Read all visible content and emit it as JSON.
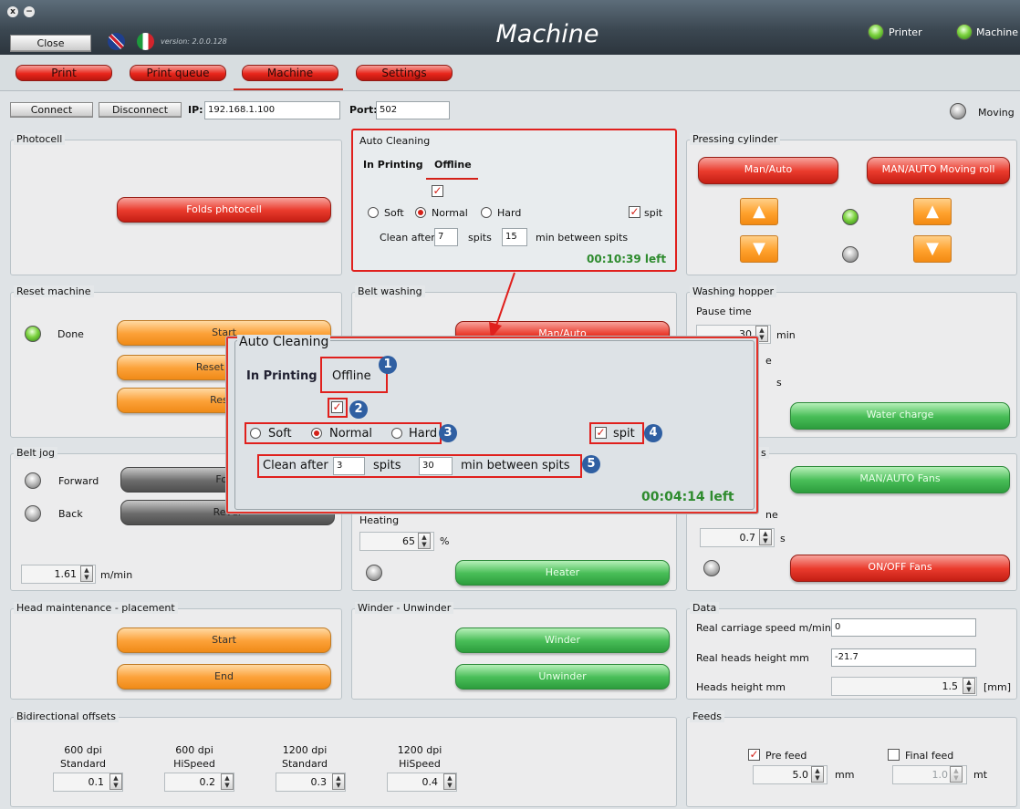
{
  "window": {
    "title": "Machine",
    "version": "version: 2.0.0.128",
    "close_label": "Close",
    "close_glyph": "x",
    "minimize_glyph": "−"
  },
  "status": {
    "printer": "Printer",
    "machine": "Machine",
    "moving": "Moving"
  },
  "tabs": [
    "Print",
    "Print queue",
    "Machine",
    "Settings"
  ],
  "connection": {
    "connect": "Connect",
    "disconnect": "Disconnect",
    "ip_label": "IP:",
    "ip_value": "192.168.1.100",
    "port_label": "Port:",
    "port_value": "502"
  },
  "photocell": {
    "title": "Photocell",
    "button": "Folds photocell"
  },
  "auto_cleaning": {
    "title": "Auto Cleaning",
    "tab_in_printing": "In Printing",
    "tab_offline": "Offline",
    "soft": "Soft",
    "normal": "Normal",
    "hard": "Hard",
    "spit": "spit",
    "clean_after": "Clean after",
    "clean_after_value": "7",
    "spits": "spits",
    "between_value": "15",
    "min_between": "min between spits",
    "time_left": "00:10:39 left"
  },
  "zoom": {
    "title": "Auto Cleaning",
    "tab_in_printing": "In Printing",
    "tab_offline": "Offline",
    "soft": "Soft",
    "normal": "Normal",
    "hard": "Hard",
    "spit": "spit",
    "clean_after": "Clean after",
    "clean_after_value": "3",
    "spits": "spits",
    "between_value": "30",
    "min_between": "min between spits",
    "time_left": "00:04:14 left",
    "badges": [
      "1",
      "2",
      "3",
      "4",
      "5"
    ]
  },
  "pressing_cylinder": {
    "title": "Pressing cylinder",
    "man_auto": "Man/Auto",
    "man_auto_moving": "MAN/AUTO Moving roll"
  },
  "reset_machine": {
    "title": "Reset machine",
    "done": "Done",
    "start": "Start",
    "reset_all": "Reset all m",
    "reset": "Reset"
  },
  "belt_washing": {
    "title": "Belt washing",
    "man_auto": "Man/Auto",
    "heating": "Heating",
    "heating_value": "65",
    "percent": "%",
    "heater": "Heater"
  },
  "washing_hopper": {
    "title": "Washing hopper",
    "pause_time": "Pause time",
    "pause_value": "30",
    "min": "min",
    "e": "e",
    "s": "s",
    "water_charge": "Water charge"
  },
  "belt_jog": {
    "title": "Belt jog",
    "forward": "Forward",
    "forward_btn": "Forw",
    "back": "Back",
    "reverse_btn": "Rever",
    "speed": "1.61",
    "unit": "m/min"
  },
  "fans": {
    "title": "s",
    "man_auto": "MAN/AUTO Fans",
    "ne": "ne",
    "time_value": "0.7",
    "s": "s",
    "on_off": "ON/OFF Fans"
  },
  "head_maintenance": {
    "title": "Head maintenance - placement",
    "start": "Start",
    "end": "End"
  },
  "winder": {
    "title": "Winder - Unwinder",
    "winder": "Winder",
    "unwinder": "Unwinder"
  },
  "data": {
    "title": "Data",
    "carriage_label": "Real carriage speed m/min",
    "carriage_value": "0",
    "heads_real_label": "Real heads height mm",
    "heads_real_value": "-21.7",
    "heads_label": "Heads height mm",
    "heads_value": "1.5",
    "heads_unit": "[mm]"
  },
  "bidirectional": {
    "title": "Bidirectional offsets",
    "items": [
      {
        "dpi": "600 dpi",
        "mode": "Standard",
        "value": "0.1"
      },
      {
        "dpi": "600 dpi",
        "mode": "HiSpeed",
        "value": "0.2"
      },
      {
        "dpi": "1200 dpi",
        "mode": "Standard",
        "value": "0.3"
      },
      {
        "dpi": "1200 dpi",
        "mode": "HiSpeed",
        "value": "0.4"
      }
    ]
  },
  "feeds": {
    "title": "Feeds",
    "pre_feed": "Pre feed",
    "pre_value": "5.0",
    "mm": "mm",
    "final_feed": "Final feed",
    "final_value": "1.0",
    "mt": "mt"
  },
  "colors": {
    "accent": "#e0201d",
    "titlebar": "#3b4751",
    "green": "#2f9e40",
    "timer": "#2e8b2e"
  }
}
